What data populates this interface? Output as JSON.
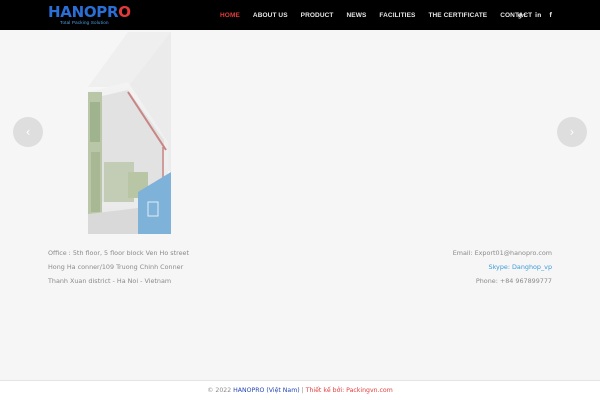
{
  "header": {
    "logo": {
      "text_main": "HANOPR",
      "text_o": "O",
      "tagline": "Total Packing Solution"
    },
    "nav": [
      {
        "label": "HOME",
        "active": true
      },
      {
        "label": "ABOUT US",
        "active": false
      },
      {
        "label": "PRODUCT",
        "active": false
      },
      {
        "label": "NEWS",
        "active": false
      },
      {
        "label": "FACILITIES",
        "active": false
      },
      {
        "label": "THE CERTIFICATE",
        "active": false
      },
      {
        "label": "CONTACT",
        "active": false
      }
    ],
    "social": {
      "google": "g+",
      "linkedin": "in",
      "facebook": "f"
    }
  },
  "slider": {
    "prev_icon": "‹",
    "next_icon": "›"
  },
  "contact": {
    "address_line1": "Office : 5th floor, 5 floor block Ven Ho street",
    "address_line2": "Hong Ha conner/109 Truong Chinh Conner",
    "address_line3": "Thanh Xuan district - Ha Noi - Vietnam",
    "email": "Email: Export01@hanopro.com",
    "skype": "Skype: Danghop_vp",
    "phone": "Phone: +84 967899777"
  },
  "footer": {
    "copyright": "© 2022",
    "brand": "HANOPRO (Việt Nam)",
    "separator": "|",
    "designed_by": "Thiết kế bởi: Packingvn.com"
  },
  "colors": {
    "accent": "#e33b3b",
    "brand_blue": "#2a6fd6",
    "skype": "#3a9bd6"
  }
}
